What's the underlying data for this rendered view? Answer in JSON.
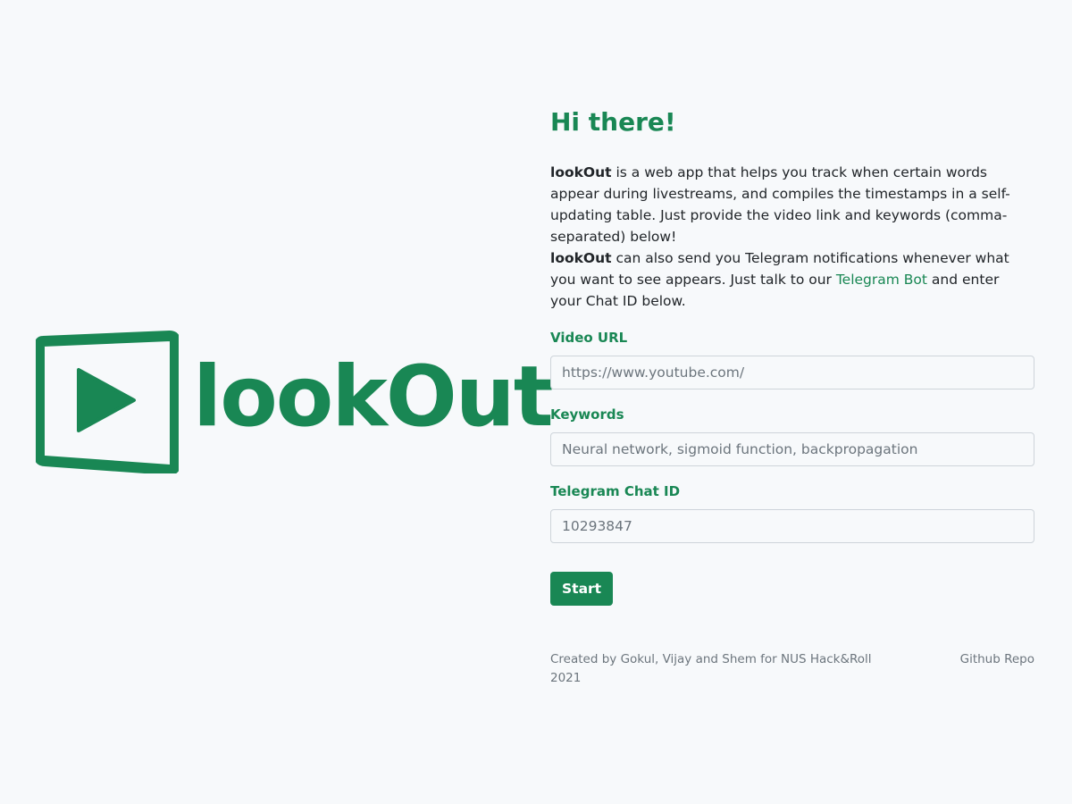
{
  "logo": {
    "text": "lookOut",
    "icon": "play-icon",
    "color": "#198754"
  },
  "heading": "Hi there!",
  "intro": {
    "app_name_1": "lookOut",
    "text_1": " is a web app that helps you track when certain words appear during livestreams, and compiles the timestamps in a self-updating table. Just provide the video link and keywords (comma-separated) below!",
    "app_name_2": "lookOut",
    "text_2a": " can also send you Telegram notifications whenever what you want to see appears. Just talk to our ",
    "bot_link": "Telegram Bot",
    "text_2b": " and enter your Chat ID below."
  },
  "form": {
    "video_url": {
      "label": "Video URL",
      "placeholder": "https://www.youtube.com/",
      "value": ""
    },
    "keywords": {
      "label": "Keywords",
      "placeholder": "Neural network, sigmoid function, backpropagation",
      "value": ""
    },
    "chat_id": {
      "label": "Telegram Chat ID",
      "placeholder": "10293847",
      "value": ""
    },
    "start_label": "Start"
  },
  "footer": {
    "credit": "Created by Gokul, Vijay and Shem for NUS Hack&Roll 2021",
    "repo_link": "Github Repo"
  },
  "colors": {
    "accent": "#198754",
    "background": "#f7f9fb",
    "muted": "#6c757d"
  }
}
